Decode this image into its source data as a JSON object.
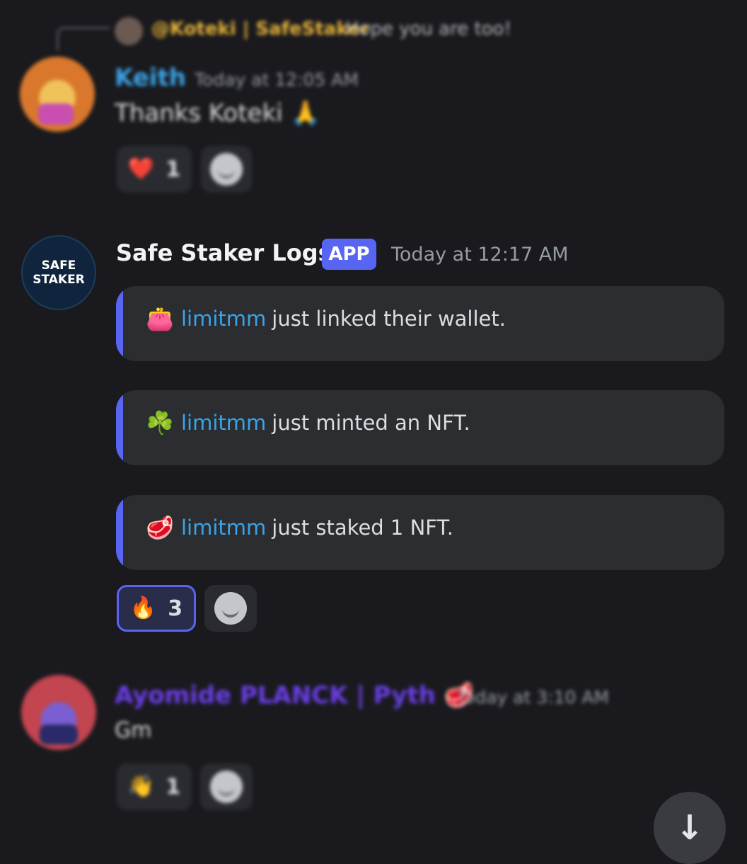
{
  "reply": {
    "author": "@Koteki | SafeStaker",
    "text": "Hope you are too!"
  },
  "messages": [
    {
      "author": "Keith",
      "timestamp": "Today at 12:05 AM",
      "text": "Thanks Koteki",
      "text_emoji": "🙏",
      "author_color": "#3ba4e6",
      "reactions": [
        {
          "emoji": "❤️",
          "icon": "heart-icon",
          "count": "1"
        }
      ]
    },
    {
      "author": "Safe Staker Logs",
      "badge": "APP",
      "timestamp": "Today at 12:17 AM",
      "avatar_text": [
        "SAFE",
        "STAKER"
      ],
      "embeds": [
        {
          "emoji": "👛",
          "icon": "purse-icon",
          "mention": "limitmm",
          "text": "just linked their wallet."
        },
        {
          "emoji": "☘️",
          "icon": "shamrock-icon",
          "mention": "limitmm",
          "text": "just minted an NFT."
        },
        {
          "emoji": "🥩",
          "icon": "steak-icon",
          "mention": "limitmm",
          "text": "just staked 1 NFT."
        }
      ],
      "reactions": [
        {
          "emoji": "🔥",
          "icon": "fire-icon",
          "count": "3"
        }
      ]
    },
    {
      "author": "Ayomide PLANCK | Pyth",
      "author_emoji": "🥩",
      "timestamp": "Today at 3:10 AM",
      "text": "Gm",
      "author_color": "#6b3ee6",
      "reactions": [
        {
          "emoji": "👋",
          "icon": "wave-hand-icon",
          "count": "1"
        }
      ]
    }
  ],
  "colors": {
    "background": "#1a1a1e",
    "accent": "#5865f2",
    "mention": "#3ba4e6",
    "embed_bg": "#2b2d31"
  }
}
